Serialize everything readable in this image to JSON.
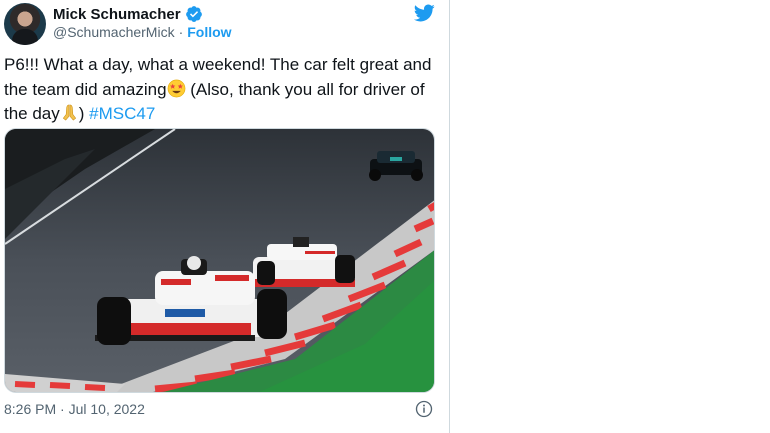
{
  "header": {
    "display_name": "Mick Schumacher",
    "handle": "@SchumacherMick",
    "separator": "·",
    "follow_label": "Follow"
  },
  "tweet": {
    "text_part1": "P6!!! What a day, what a weekend! The car felt great and the team did amazing",
    "text_part2": " (Also, thank you all for driver of the day",
    "text_part3": ") ",
    "hashtag": "#MSC47"
  },
  "footer": {
    "timestamp": "8:26 PM · Jul 10, 2022"
  },
  "icons": {
    "brand": "twitter-bird-icon",
    "verified": "verified-badge-icon",
    "info": "info-icon",
    "emoji_1": "star-struck-emoji",
    "emoji_2": "folded-hands-emoji"
  },
  "colors": {
    "accent": "#1d9bf0",
    "secondary_text": "#536471",
    "primary_text": "#0f1419",
    "border": "#cfd9de"
  }
}
